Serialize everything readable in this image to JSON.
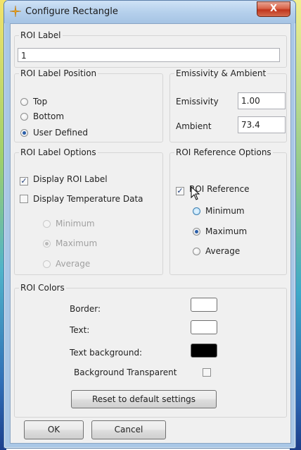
{
  "window": {
    "title": "Configure Rectangle",
    "close_label": "X"
  },
  "roi_label": {
    "legend": "ROI Label",
    "value": "1"
  },
  "label_position": {
    "legend": "ROI Label Position",
    "options": [
      "Top",
      "Bottom",
      "User Defined"
    ],
    "selected": "User Defined"
  },
  "emissivity_ambient": {
    "legend": "Emissivity & Ambient",
    "emissivity_label": "Emissivity",
    "emissivity_value": "1.00",
    "ambient_label": "Ambient",
    "ambient_value": "73.4"
  },
  "label_options": {
    "legend": "ROI Label Options",
    "display_roi_label": "Display ROI Label",
    "display_roi_label_checked": true,
    "display_temperature_data": "Display Temperature Data",
    "display_temperature_data_checked": false,
    "temp_options": [
      "Minimum",
      "Maximum",
      "Average"
    ],
    "temp_selected": "Maximum"
  },
  "reference_options": {
    "legend": "ROI Reference Options",
    "roi_reference": "ROI Reference",
    "roi_reference_checked": true,
    "options": [
      "Minimum",
      "Maximum",
      "Average"
    ],
    "selected": "Maximum"
  },
  "roi_colors": {
    "legend": "ROI Colors",
    "border_label": "Border:",
    "border_color": "#ffffff",
    "text_label": "Text:",
    "text_color": "#ffffff",
    "text_background_label": "Text background:",
    "text_background_color": "#000000",
    "background_transparent": "Background Transparent",
    "background_transparent_checked": false,
    "reset_label": "Reset to default settings"
  },
  "buttons": {
    "ok": "OK",
    "cancel": "Cancel"
  },
  "check_glyph": "✓",
  "colors": {
    "title_bar": "#b6d0ec",
    "close_button": "#c0351d",
    "dialog_background": "#f0f0f0",
    "radio_selected": "#2a5ea8"
  }
}
